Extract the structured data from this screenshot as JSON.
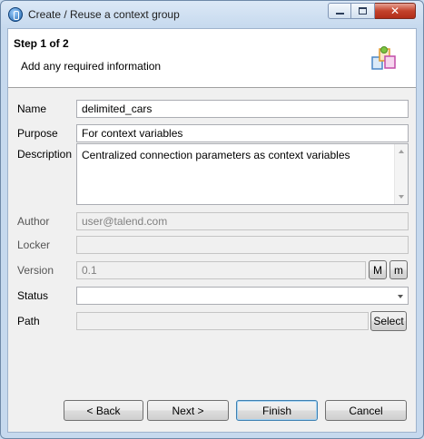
{
  "window": {
    "title": "Create / Reuse a context group",
    "minimize_label": "minimize",
    "maximize_label": "maximize",
    "close_label": "✕"
  },
  "header": {
    "step": "Step 1 of 2",
    "subtitle": "Add any required information"
  },
  "form": {
    "name_label": "Name",
    "name_value": "delimited_cars",
    "purpose_label": "Purpose",
    "purpose_value": "For context variables",
    "description_label": "Description",
    "description_value": "Centralized connection parameters as context variables",
    "author_label": "Author",
    "author_value": "user@talend.com",
    "locker_label": "Locker",
    "locker_value": "",
    "version_label": "Version",
    "version_value": "0.1",
    "version_major_button": "M",
    "version_minor_button": "m",
    "status_label": "Status",
    "status_value": "",
    "path_label": "Path",
    "path_value": "",
    "select_button": "Select"
  },
  "footer": {
    "back": "< Back",
    "next": "Next >",
    "finish": "Finish",
    "cancel": "Cancel"
  }
}
